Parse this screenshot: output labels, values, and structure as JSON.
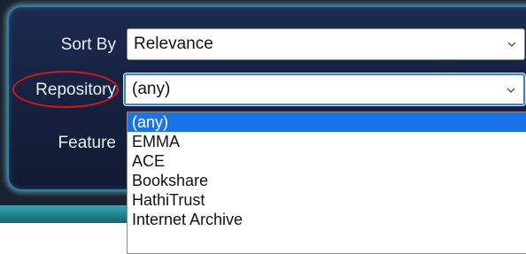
{
  "search": {
    "sort_by": {
      "label": "Sort By",
      "value": "Relevance"
    },
    "repository": {
      "label": "Repository",
      "value": "(any)",
      "options": [
        "(any)",
        "EMMA",
        "ACE",
        "Bookshare",
        "HathiTrust",
        "Internet Archive"
      ],
      "highlighted_option": "(any)"
    },
    "feature": {
      "label": "Feature"
    }
  },
  "colors": {
    "panel_bg": "#1d2a4f",
    "panel_glow": "#2f7fa0",
    "highlight": "#1a73e8",
    "annotation_circle": "#d4161d",
    "teal_bar": "#2a939e"
  },
  "icons": {
    "select_arrow": "chevron-down-icon"
  }
}
